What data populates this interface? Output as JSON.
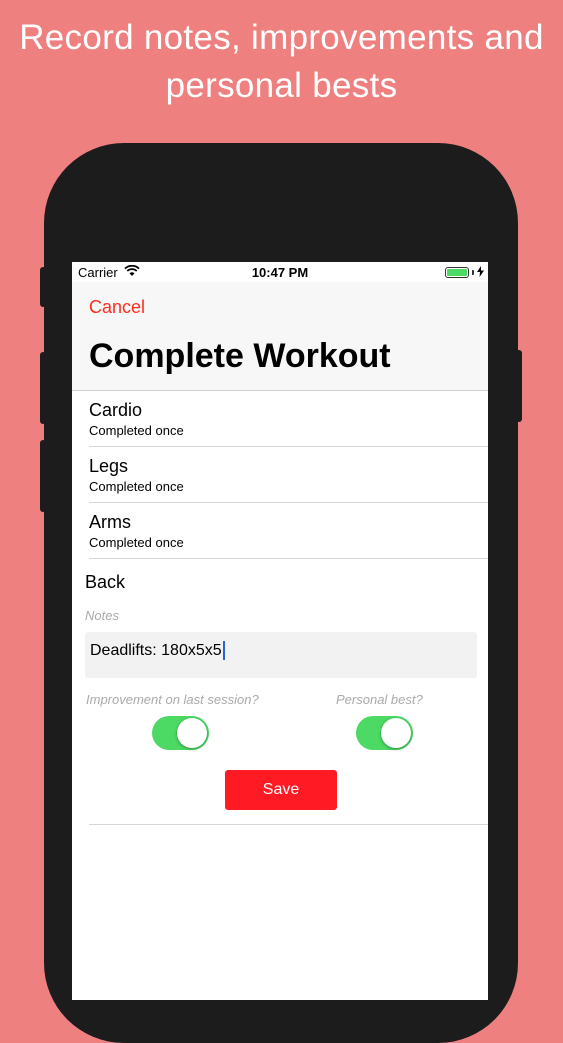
{
  "headline": {
    "line1": "Record notes, improvements and",
    "line2": "personal bests"
  },
  "status_bar": {
    "carrier": "Carrier",
    "time": "10:47 PM",
    "battery_level": 1.0
  },
  "nav": {
    "cancel_label": "Cancel",
    "title": "Complete Workout"
  },
  "workouts": [
    {
      "name": "Cardio",
      "status": "Completed once"
    },
    {
      "name": "Legs",
      "status": "Completed once"
    },
    {
      "name": "Arms",
      "status": "Completed once"
    }
  ],
  "current": {
    "name": "Back",
    "notes_label": "Notes",
    "notes_value": "Deadlifts: 180x5x5"
  },
  "toggles": {
    "improvement_label": "Improvement on last session?",
    "improvement_on": true,
    "personal_best_label": "Personal best?",
    "personal_best_on": true
  },
  "save_label": "Save",
  "colors": {
    "background": "#ef8080",
    "accent_red": "#ff2d20",
    "save_button": "#ff1a24",
    "toggle_on": "#4cd964"
  }
}
